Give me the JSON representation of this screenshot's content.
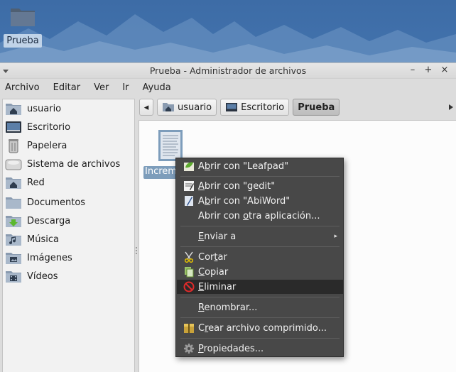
{
  "desktop": {
    "icon_label": "Prueba"
  },
  "window": {
    "title": "Prueba - Administrador de archivos",
    "controls": {
      "minimize": "–",
      "maximize": "+",
      "close": "×"
    }
  },
  "menubar": [
    "Archivo",
    "Editar",
    "Ver",
    "Ir",
    "Ayuda"
  ],
  "sidebar": {
    "items": [
      {
        "label": "usuario",
        "icon": "home-folder-icon"
      },
      {
        "label": "Escritorio",
        "icon": "desktop-icon"
      },
      {
        "label": "Papelera",
        "icon": "trash-icon"
      },
      {
        "label": "Sistema de archivos",
        "icon": "drive-icon"
      },
      {
        "label": "Red",
        "icon": "network-folder-icon"
      },
      {
        "label": "Documentos",
        "icon": "folder-icon"
      },
      {
        "label": "Descarga",
        "icon": "download-folder-icon"
      },
      {
        "label": "Música",
        "icon": "music-folder-icon"
      },
      {
        "label": "Imágenes",
        "icon": "pictures-folder-icon"
      },
      {
        "label": "Vídeos",
        "icon": "videos-folder-icon"
      }
    ]
  },
  "pathbar": {
    "back": "◂",
    "crumbs": [
      "usuario",
      "Escritorio",
      "Prueba"
    ],
    "active": "Prueba"
  },
  "file": {
    "name": "Incremento"
  },
  "context_menu": {
    "open_leafpad": {
      "pre": "A",
      "u": "b",
      "post": "rir con \"Leafpad\""
    },
    "open_gedit": {
      "pre": "",
      "u": "A",
      "post": "brir con \"gedit\""
    },
    "open_abiword": {
      "pre": "A",
      "u": "b",
      "post": "rir con \"AbiWord\""
    },
    "open_other": {
      "pre": "Abrir con ",
      "u": "o",
      "post": "tra aplicación..."
    },
    "send_to": {
      "pre": "",
      "u": "E",
      "post": "nviar a"
    },
    "cut": {
      "pre": "Cor",
      "u": "t",
      "post": "ar"
    },
    "copy": {
      "pre": "",
      "u": "C",
      "post": "opiar"
    },
    "delete": {
      "pre": "",
      "u": "E",
      "post": "liminar"
    },
    "rename": {
      "pre": "",
      "u": "R",
      "post": "enombrar..."
    },
    "compress": {
      "pre": "C",
      "u": "r",
      "post": "ear archivo comprimido..."
    },
    "properties": {
      "pre": "",
      "u": "P",
      "post": "ropiedades..."
    },
    "submenu_arrow": "▸"
  },
  "colors": {
    "menu_bg": "#484848",
    "menu_highlight": "#2a2a2a",
    "selection": "#7d9dbb"
  }
}
